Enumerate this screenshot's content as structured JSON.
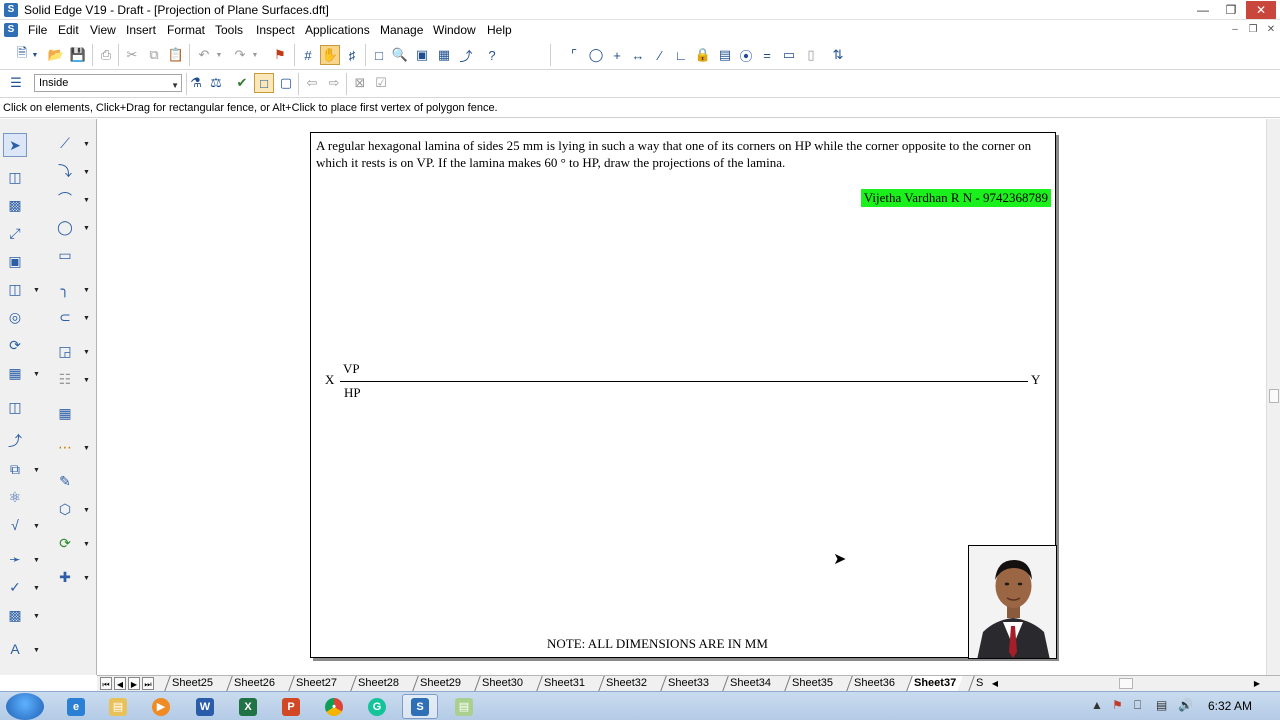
{
  "window": {
    "title": "Solid Edge V19 - Draft - [Projection of Plane Surfaces.dft]",
    "icon_name": "solid-edge-icon"
  },
  "menu": {
    "items": [
      "File",
      "Edit",
      "View",
      "Insert",
      "Format",
      "Tools",
      "Inspect",
      "Applications",
      "Manage",
      "Window",
      "Help"
    ]
  },
  "toolbar": {
    "select_filter_value": "Inside"
  },
  "prompt": {
    "text": "Click on elements, Click+Drag for rectangular fence, or Alt+Click to place first vertex of polygon fence."
  },
  "sheet": {
    "problem_text": "A regular hexagonal lamina of sides 25 mm is lying in such a way that one of its corners on HP while the corner opposite to the corner on which it rests is on VP. If the lamina makes 60 ° to HP, draw the projections of the lamina.",
    "author_label": "Vijetha Vardhan R N - 9742368789",
    "author_highlight_color": "#1cf01c",
    "x_label": "X",
    "y_label": "Y",
    "vp_label": "VP",
    "hp_label": "HP",
    "note": "NOTE: ALL DIMENSIONS ARE IN MM"
  },
  "tabs": {
    "items": [
      "Sheet25",
      "Sheet26",
      "Sheet27",
      "Sheet28",
      "Sheet29",
      "Sheet30",
      "Sheet31",
      "Sheet32",
      "Sheet33",
      "Sheet34",
      "Sheet35",
      "Sheet36",
      "Sheet37",
      "S"
    ],
    "active": "Sheet37"
  },
  "taskbar": {
    "clock": "6:32 AM",
    "apps": [
      "internet-explorer",
      "file-explorer",
      "media-player",
      "word",
      "excel",
      "powerpoint",
      "chrome",
      "grammarly",
      "solid-edge",
      "folder"
    ]
  }
}
